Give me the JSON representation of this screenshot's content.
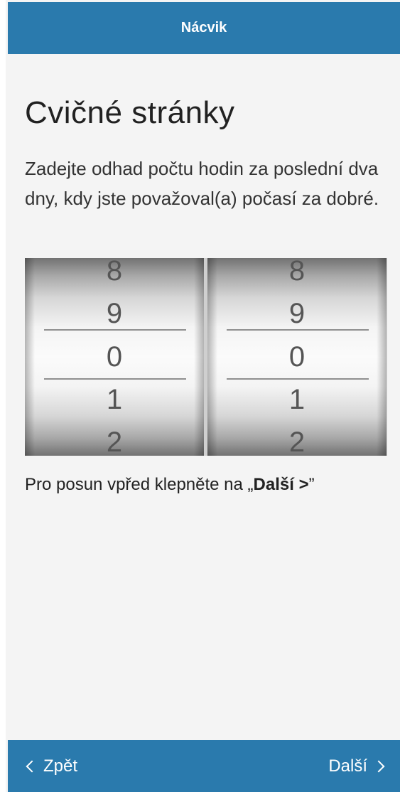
{
  "header": {
    "title": "Nácvik",
    "color": "#2a7aad"
  },
  "main": {
    "title": "Cvičné stránky",
    "prompt": "Zadejte odhad počtu hodin za poslední dva dny, kdy jste považoval(a) počasí za dobré.",
    "picker": {
      "wheels": [
        {
          "visible_values": [
            "8",
            "9",
            "0",
            "1",
            "2"
          ],
          "selected_value": "0"
        },
        {
          "visible_values": [
            "8",
            "9",
            "0",
            "1",
            "2"
          ],
          "selected_value": "0"
        }
      ]
    },
    "hint": {
      "prefix": "Pro posun vpřed klepněte na „",
      "bold": "Další >",
      "suffix": "”"
    }
  },
  "footer": {
    "back_label": "Zpět",
    "back_icon": "chevron-left-icon",
    "next_label": "Další",
    "next_icon": "chevron-right-icon"
  }
}
